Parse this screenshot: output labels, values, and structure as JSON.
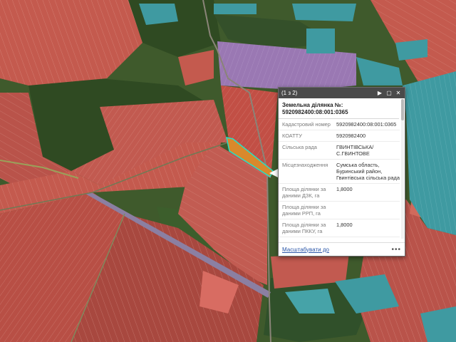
{
  "map": {
    "colors": {
      "ground": "#3f5a2c",
      "parcel_red": "#c45a4e",
      "parcel_red_dark": "#a8483f",
      "parcel_purple": "#9a78b3",
      "parcel_teal": "#3f9aa1",
      "forest": "#2f4a22",
      "selected_outline": "#26e0c6",
      "selected_fill": "#d9892c",
      "road": "#8a8478"
    }
  },
  "popup": {
    "counter": "(1 з 2)",
    "title_label": "Земельна ділянка №:",
    "title_value": "5920982400:08:001:0365",
    "fields": [
      {
        "label": "Кадастровий номер",
        "value": "5920982400:08:001:0365"
      },
      {
        "label": "КОАТТУ",
        "value": "5920982400"
      },
      {
        "label": "Сільська рада",
        "value": "ГВИНТІВСЬКА/ С.ГВИНТОВЕ"
      },
      {
        "label": "Місцезнаходження",
        "value": "Сумська область, Буринський район, Гвинтівська сільська рада"
      },
      {
        "label": "Площа ділянки за даними ДЗК, га",
        "value": "1,8000"
      },
      {
        "label": "Площа ділянки за даними РРП, га",
        "value": ""
      },
      {
        "label": "Площа ділянки за даними ПККУ, га",
        "value": "1,8000"
      }
    ],
    "zoom_link": "Масштабувати до",
    "more": "•••",
    "icons": [
      "next-icon",
      "maximize-icon",
      "close-icon"
    ]
  }
}
